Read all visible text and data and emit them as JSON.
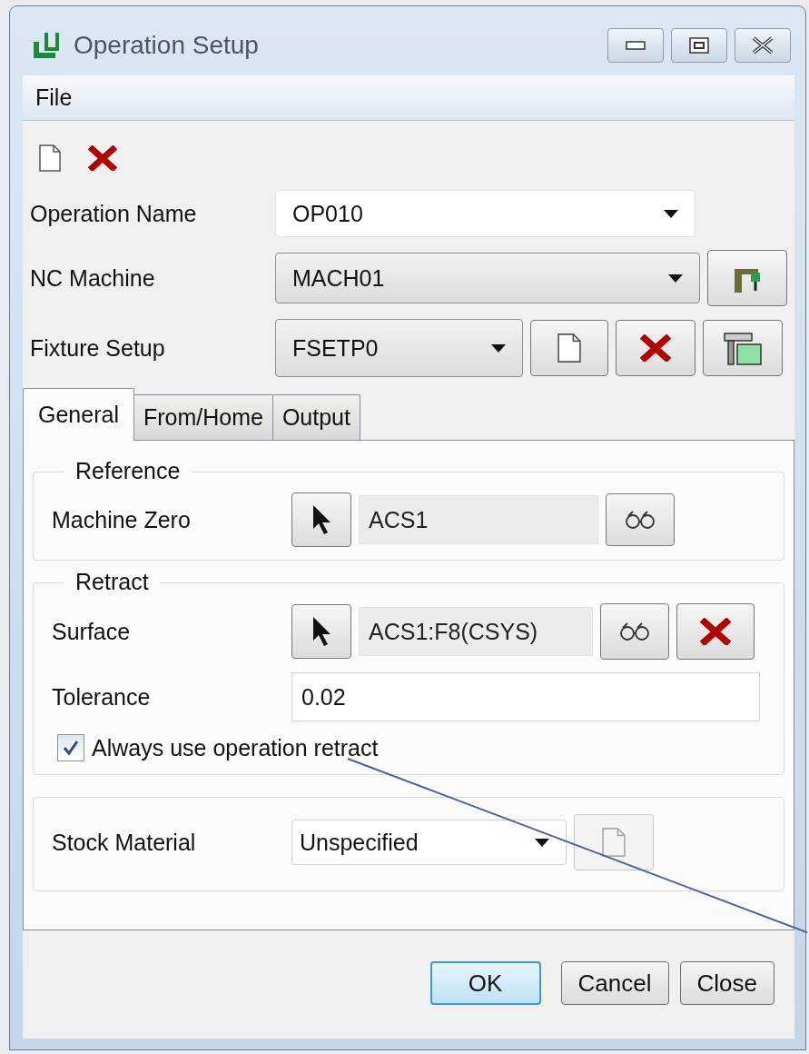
{
  "window": {
    "title": "Operation Setup"
  },
  "menu": [
    {
      "label": "File"
    }
  ],
  "fields": [
    {
      "kind": "combo",
      "label": "Operation Name",
      "value": "OP010"
    },
    {
      "kind": "machine",
      "label": "NC Machine",
      "value": "MACH01"
    },
    {
      "kind": "fixture",
      "label": "Fixture Setup",
      "value": "FSETP0"
    }
  ],
  "tabs": [
    {
      "label": "General",
      "selected": true
    },
    {
      "label": "From/Home",
      "selected": false
    },
    {
      "label": "Output",
      "selected": false
    }
  ],
  "reference": {
    "title": "Reference",
    "label": "Machine Zero",
    "value": "ACS1"
  },
  "retract": {
    "title": "Retract",
    "surface_label": "Surface",
    "surface_value": "ACS1:F8(CSYS)",
    "tolerance_label": "Tolerance",
    "tolerance_value": "0.02",
    "checkbox": {
      "label": "Always use operation retract",
      "checked": true
    }
  },
  "stock": {
    "label": "Stock Material",
    "value": "Unspecified",
    "new_disabled": true
  },
  "buttons": [
    {
      "label": "OK",
      "default": true
    },
    {
      "label": "Cancel",
      "default": false
    },
    {
      "label": "Close",
      "default": false
    }
  ]
}
